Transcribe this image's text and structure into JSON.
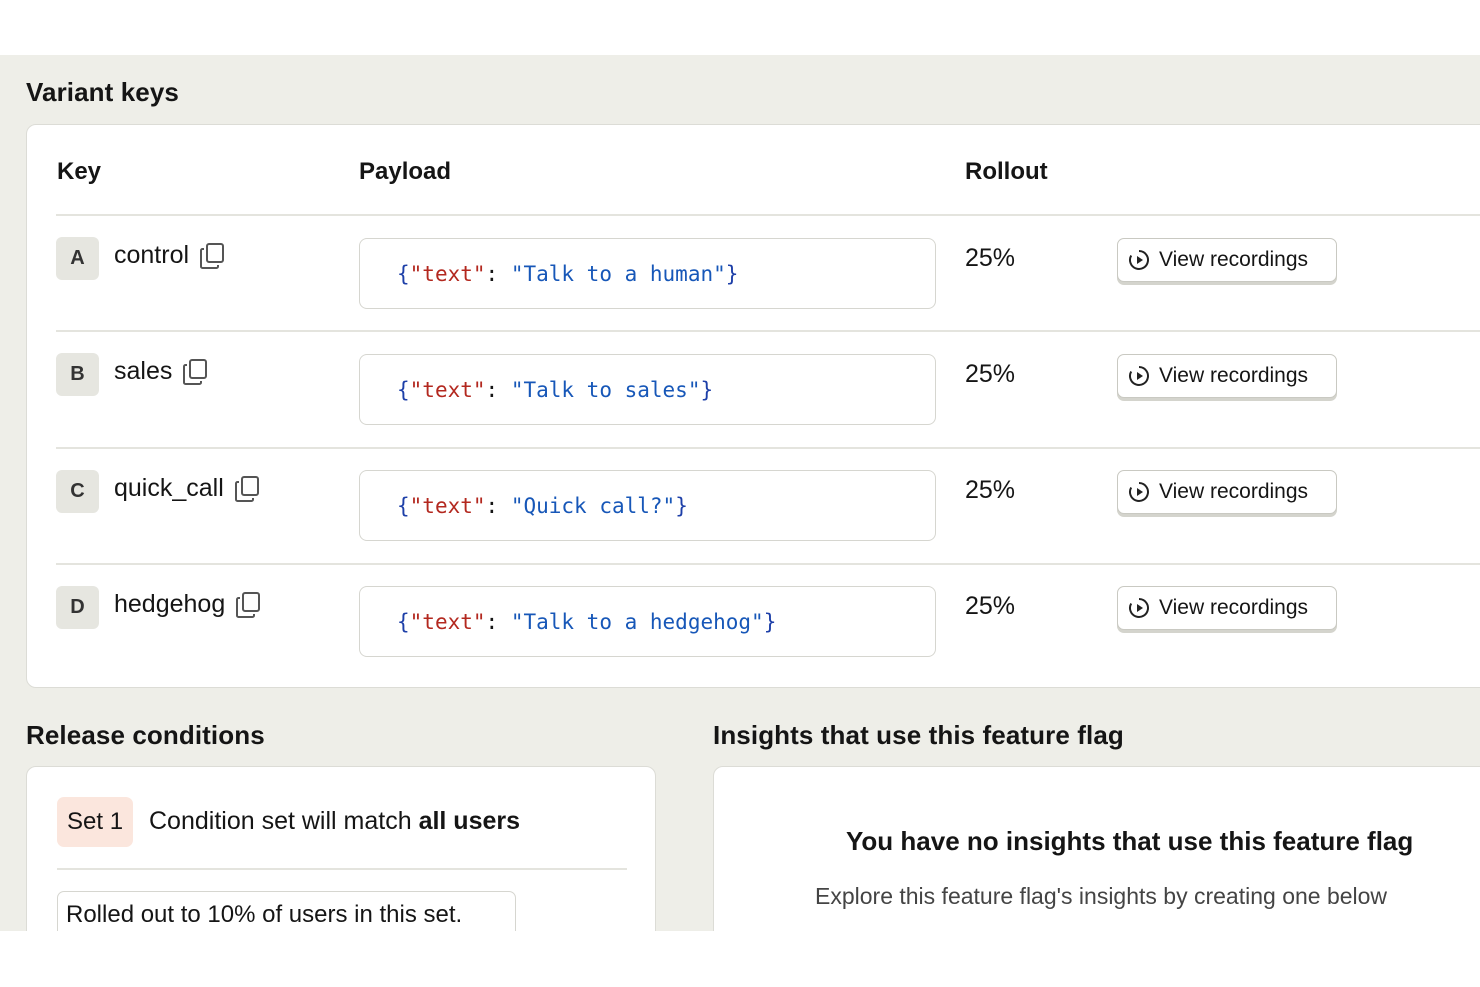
{
  "variant_keys": {
    "title": "Variant keys",
    "columns": {
      "key": "Key",
      "payload": "Payload",
      "rollout": "Rollout"
    },
    "view_recordings_label": "View recordings",
    "rows": [
      {
        "letter": "A",
        "name": "control",
        "payload": {
          "open": "{",
          "key": "\"text\"",
          "colon": ": ",
          "value": "\"Talk to a human\"",
          "close": "}"
        },
        "rollout": "25%"
      },
      {
        "letter": "B",
        "name": "sales",
        "payload": {
          "open": "{",
          "key": "\"text\"",
          "colon": ": ",
          "value": "\"Talk to sales\"",
          "close": "}"
        },
        "rollout": "25%"
      },
      {
        "letter": "C",
        "name": "quick_call",
        "payload": {
          "open": "{",
          "key": "\"text\"",
          "colon": ": ",
          "value": "\"Quick call?\"",
          "close": "}"
        },
        "rollout": "25%"
      },
      {
        "letter": "D",
        "name": "hedgehog",
        "payload": {
          "open": "{",
          "key": "\"text\"",
          "colon": ": ",
          "value": "\"Talk to a hedgehog\"",
          "close": "}"
        },
        "rollout": "25%"
      }
    ]
  },
  "release_conditions": {
    "title": "Release conditions",
    "set_label": "Set 1",
    "match_prefix": "Condition set will match ",
    "match_bold": "all users",
    "rollout_text": "Rolled out to 10% of users in this set."
  },
  "insights": {
    "title": "Insights that use this feature flag",
    "empty_title": "You have no insights that use this feature flag",
    "empty_subtitle": "Explore this feature flag's insights by creating one below"
  },
  "colors": {
    "background": "#eeeee8",
    "json_key": "#b3281f",
    "json_value": "#1757b8",
    "set_badge": "#fbe6dd"
  },
  "icons": {
    "copy": "copy-icon",
    "recording": "play-circle-icon"
  }
}
